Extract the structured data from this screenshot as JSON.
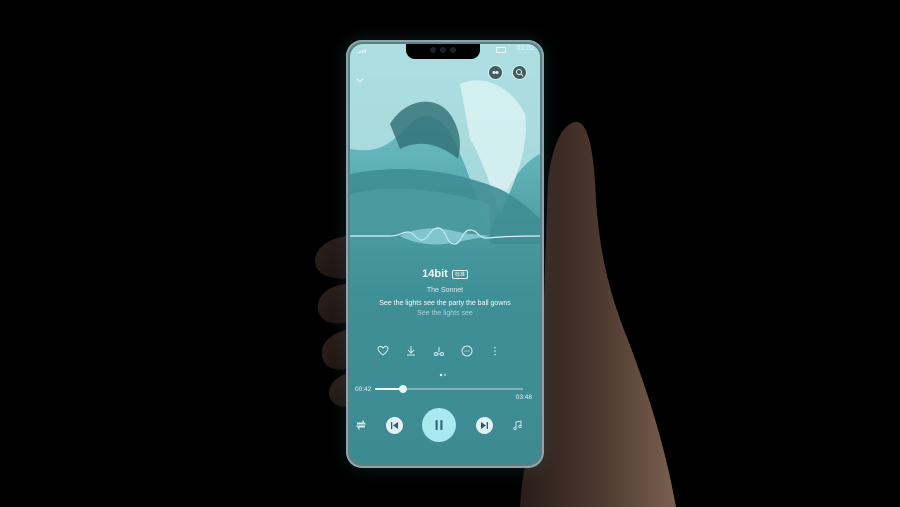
{
  "status": {
    "time": "03:02"
  },
  "player": {
    "title": "14bit",
    "quality_badge": "标准",
    "artist": "The Sonnet",
    "lyric_current": "See the lights see the party the ball gowns",
    "lyric_next": "See the lights see",
    "time_current": "00:42",
    "time_total": "03:48",
    "progress": 0.19,
    "page_dots": 2,
    "active_page": 0
  },
  "icons": {
    "back": "chevron-down-icon",
    "top_left": "dolby-icon",
    "top_right": "search-icon",
    "actions": [
      "heart-icon",
      "download-icon",
      "share-icon",
      "comment-icon",
      "more-icon"
    ],
    "left_side": "queue-icon",
    "right_side": "playlist-icon",
    "prev": "previous-icon",
    "pause": "pause-icon",
    "next": "next-icon"
  },
  "colors": {
    "background": "#000000",
    "screen_teal": "#4a9aa1",
    "accent": "#a8eaf0"
  }
}
